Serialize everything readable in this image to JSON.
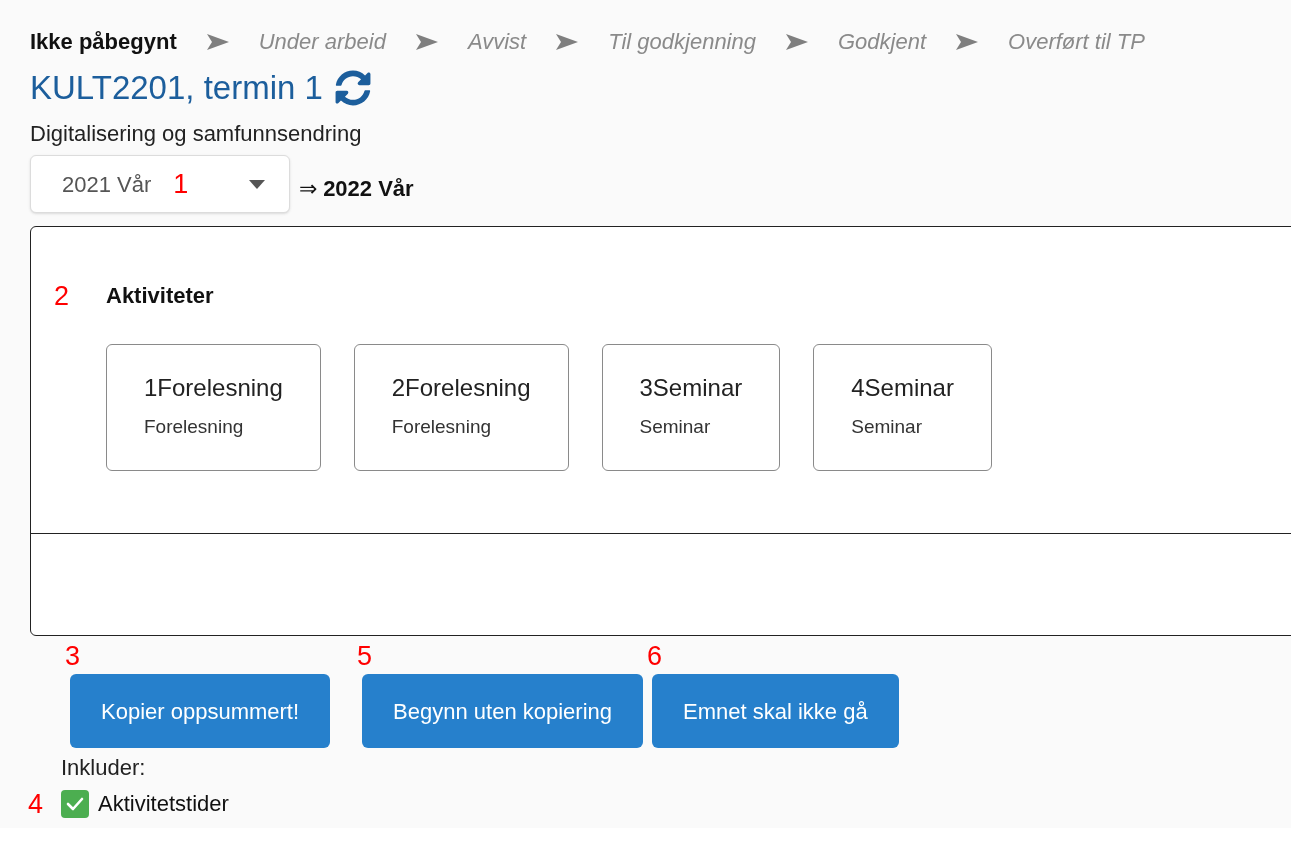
{
  "status_steps": [
    {
      "label": "Ikke påbegynt",
      "selected": true
    },
    {
      "label": "Under arbeid",
      "selected": false
    },
    {
      "label": "Avvist",
      "selected": false
    },
    {
      "label": "Til godkjenning",
      "selected": false
    },
    {
      "label": "Godkjent",
      "selected": false
    },
    {
      "label": "Overført til TP",
      "selected": false
    }
  ],
  "course": {
    "title": "KULT2201, termin 1",
    "subtitle": "Digitalisering og samfunnsendring"
  },
  "semester": {
    "select": {
      "value": "2021 Vår",
      "annotation": "1"
    },
    "target": "⇒ **2022 Vår**"
  },
  "activities_panel": {
    "annotation": "2",
    "heading": "Aktiviteter",
    "activities": [
      {
        "name": "1Forelesning",
        "type": "Forelesning"
      },
      {
        "name": "2Forelesning",
        "type": "Forelesning"
      },
      {
        "name": "3Seminar",
        "type": "Seminar"
      },
      {
        "name": "4Seminar",
        "type": "Seminar"
      }
    ]
  },
  "actions": [
    {
      "label": "Kopier oppsummert!",
      "annotation": "3"
    },
    {
      "label": "Begynn uten kopiering",
      "annotation": "5"
    },
    {
      "label": "Emnet skal ikke gå",
      "annotation": "6"
    }
  ],
  "include": {
    "label": "Inkluder:",
    "options": [
      {
        "label": "Aktivitetstider",
        "checked": true,
        "annotation": "4"
      }
    ]
  }
}
